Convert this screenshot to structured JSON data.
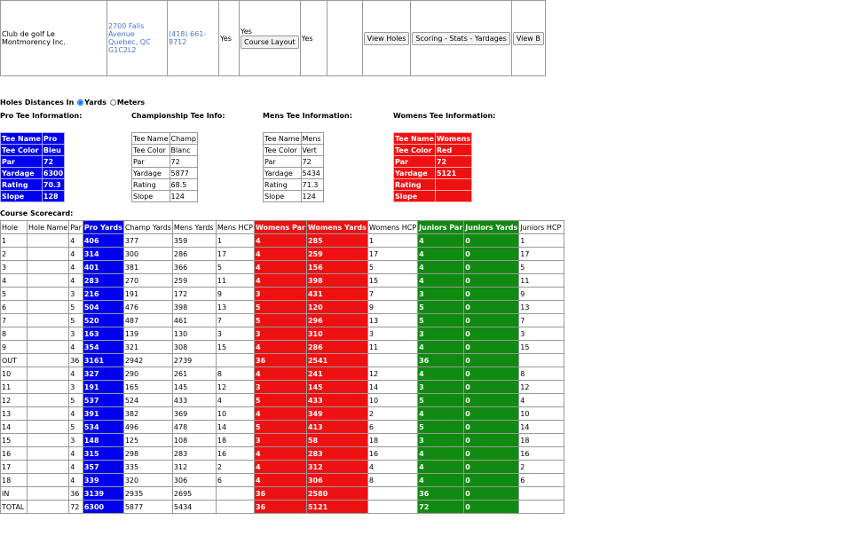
{
  "course": {
    "name": "Club de golf Le Montmorency Inc.",
    "address_line1": "2700 Falls Avenue",
    "address_line2": "Quebec, QC",
    "address_line3": "G1C2L2",
    "phone": "(418) 661-8712",
    "col_yes1": "Yes",
    "layout_yes": "Yes",
    "layout_button": "Course Layout",
    "col_yes2": "Yes",
    "view_holes_button": "View Holes",
    "scoring_button": "Scoring - Stats - Yardages",
    "view_b_button": "View B"
  },
  "units": {
    "label": "Holes Distances In",
    "yards": "Yards",
    "meters": "Meters"
  },
  "tees": [
    {
      "title": "Pro Tee Information:",
      "style": "blue",
      "rows": [
        [
          "Tee Name",
          "Pro"
        ],
        [
          "Tee Color",
          "Bleu"
        ],
        [
          "Par",
          "72"
        ],
        [
          "Yardage",
          "6300"
        ],
        [
          "Rating",
          "70.3"
        ],
        [
          "Slope",
          "128"
        ]
      ]
    },
    {
      "title": "Championship Tee Info:",
      "style": "plain",
      "rows": [
        [
          "Tee Name",
          "Champ"
        ],
        [
          "Tee Color",
          "Blanc"
        ],
        [
          "Par",
          "72"
        ],
        [
          "Yardage",
          "5877"
        ],
        [
          "Rating",
          "68.5"
        ],
        [
          "Slope",
          "124"
        ]
      ]
    },
    {
      "title": "Mens Tee Information:",
      "style": "plain",
      "rows": [
        [
          "Tee Name",
          "Mens"
        ],
        [
          "Tee Color",
          "Vert"
        ],
        [
          "Par",
          "72"
        ],
        [
          "Yardage",
          "5434"
        ],
        [
          "Rating",
          "71.3"
        ],
        [
          "Slope",
          "124"
        ]
      ]
    },
    {
      "title": "Womens Tee Information:",
      "style": "red",
      "rows": [
        [
          "Tee Name",
          "Womens"
        ],
        [
          "Tee Color",
          "Red"
        ],
        [
          "Par",
          "72"
        ],
        [
          "Yardage",
          "5121"
        ],
        [
          "Rating",
          ""
        ],
        [
          "Slope",
          ""
        ]
      ]
    }
  ],
  "scorecard": {
    "title": "Course Scorecard:",
    "headers": [
      "Hole",
      "Hole Name",
      "Par",
      "Pro Yards",
      "Champ Yards",
      "Mens Yards",
      "Mens HCP",
      "Womens Par",
      "Womens Yards",
      "Womens HCP",
      "Juniors Par",
      "Juniors Yards",
      "Juniors HCP"
    ],
    "rows": [
      [
        "1",
        "",
        "4",
        "406",
        "377",
        "359",
        "1",
        "4",
        "285",
        "1",
        "4",
        "0",
        "1"
      ],
      [
        "2",
        "",
        "4",
        "314",
        "300",
        "286",
        "17",
        "4",
        "259",
        "17",
        "4",
        "0",
        "17"
      ],
      [
        "3",
        "",
        "4",
        "401",
        "381",
        "366",
        "5",
        "4",
        "156",
        "5",
        "4",
        "0",
        "5"
      ],
      [
        "4",
        "",
        "4",
        "283",
        "270",
        "259",
        "11",
        "4",
        "398",
        "15",
        "4",
        "0",
        "11"
      ],
      [
        "5",
        "",
        "3",
        "216",
        "191",
        "172",
        "9",
        "3",
        "431",
        "7",
        "3",
        "0",
        "9"
      ],
      [
        "6",
        "",
        "5",
        "504",
        "476",
        "398",
        "13",
        "5",
        "120",
        "9",
        "5",
        "0",
        "13"
      ],
      [
        "7",
        "",
        "5",
        "520",
        "487",
        "461",
        "7",
        "5",
        "296",
        "13",
        "5",
        "0",
        "7"
      ],
      [
        "8",
        "",
        "3",
        "163",
        "139",
        "130",
        "3",
        "3",
        "310",
        "3",
        "3",
        "0",
        "3"
      ],
      [
        "9",
        "",
        "4",
        "354",
        "321",
        "308",
        "15",
        "4",
        "286",
        "11",
        "4",
        "0",
        "15"
      ],
      [
        "OUT",
        "",
        "36",
        "3161",
        "2942",
        "2739",
        "",
        "36",
        "2541",
        "",
        "36",
        "0",
        ""
      ],
      [
        "10",
        "",
        "4",
        "327",
        "290",
        "261",
        "8",
        "4",
        "241",
        "12",
        "4",
        "0",
        "8"
      ],
      [
        "11",
        "",
        "3",
        "191",
        "165",
        "145",
        "12",
        "3",
        "145",
        "14",
        "3",
        "0",
        "12"
      ],
      [
        "12",
        "",
        "5",
        "537",
        "524",
        "433",
        "4",
        "5",
        "433",
        "10",
        "5",
        "0",
        "4"
      ],
      [
        "13",
        "",
        "4",
        "391",
        "382",
        "369",
        "10",
        "4",
        "349",
        "2",
        "4",
        "0",
        "10"
      ],
      [
        "14",
        "",
        "5",
        "534",
        "496",
        "478",
        "14",
        "5",
        "413",
        "6",
        "5",
        "0",
        "14"
      ],
      [
        "15",
        "",
        "3",
        "148",
        "125",
        "108",
        "18",
        "3",
        "58",
        "18",
        "3",
        "0",
        "18"
      ],
      [
        "16",
        "",
        "4",
        "315",
        "298",
        "283",
        "16",
        "4",
        "283",
        "16",
        "4",
        "0",
        "16"
      ],
      [
        "17",
        "",
        "4",
        "357",
        "335",
        "312",
        "2",
        "4",
        "312",
        "4",
        "4",
        "0",
        "2"
      ],
      [
        "18",
        "",
        "4",
        "339",
        "320",
        "306",
        "6",
        "4",
        "306",
        "8",
        "4",
        "0",
        "6"
      ],
      [
        "IN",
        "",
        "36",
        "3139",
        "2935",
        "2695",
        "",
        "36",
        "2580",
        "",
        "36",
        "0",
        ""
      ],
      [
        "TOTAL",
        "",
        "72",
        "6300",
        "5877",
        "5434",
        "",
        "36",
        "5121",
        "",
        "72",
        "0",
        ""
      ]
    ]
  },
  "colors": {
    "pro": "#0000ee",
    "womens": "#ee1111",
    "juniors": "#108a10"
  }
}
